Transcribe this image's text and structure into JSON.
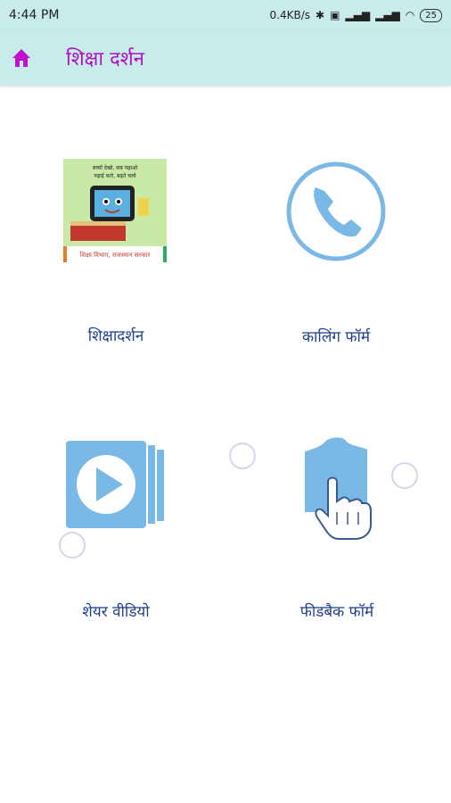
{
  "status_bar": {
    "time": "4:44 PM",
    "speed": "0.4KB/s",
    "battery": "25"
  },
  "app_bar": {
    "title": "शिक्षा दर्शन"
  },
  "logo": {
    "top_text_1": "बच्चों देखो, सब पढ़ाओ",
    "top_text_2": "पढ़ाई करो, बढ़ते चलो",
    "bottom_text": "शिक्षा विभाग, राजस्थान सरकार"
  },
  "tiles": [
    {
      "label": "शिक्षादर्शन"
    },
    {
      "label": "कालिंग फॉर्म"
    },
    {
      "label": "शेयर वीडियो"
    },
    {
      "label": "फीडबैक फॉर्म"
    }
  ],
  "colors": {
    "app_bar_bg": "#c8ecea",
    "title_color": "#b010c8",
    "label_color": "#1f3f8f",
    "icon_blue": "#7ab8e6"
  }
}
